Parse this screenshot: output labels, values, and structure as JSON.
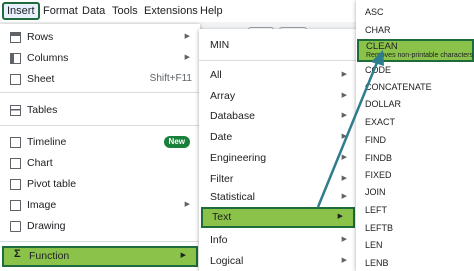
{
  "menubar": {
    "items": [
      "Insert",
      "Format",
      "Data",
      "Tools",
      "Extensions",
      "Help"
    ]
  },
  "insert_menu": {
    "items": [
      {
        "label": "Rows",
        "icon": "rows-icon"
      },
      {
        "label": "Columns",
        "icon": "columns-icon"
      },
      {
        "label": "Sheet",
        "icon": "sheet-icon",
        "shortcut": "Shift+F11"
      },
      {
        "label": "Tables",
        "icon": "tables-icon"
      },
      {
        "label": "Timeline",
        "icon": "timeline-icon",
        "badge": "New"
      },
      {
        "label": "Chart",
        "icon": "chart-icon"
      },
      {
        "label": "Pivot table",
        "icon": "pivot-table-icon"
      },
      {
        "label": "Image",
        "icon": "image-icon"
      },
      {
        "label": "Drawing",
        "icon": "drawing-icon"
      },
      {
        "label": "Function",
        "icon": "sigma-icon",
        "icon_glyph": "Σ"
      }
    ]
  },
  "function_menu": {
    "items": [
      "MIN",
      "All",
      "Array",
      "Database",
      "Date",
      "Engineering",
      "Filter",
      "Statistical",
      "Text",
      "Info",
      "Logical"
    ]
  },
  "text_menu": {
    "items": [
      "ASC",
      "CHAR",
      "CODE",
      "CONCATENATE",
      "DOLLAR",
      "EXACT",
      "FIND",
      "FINDB",
      "FIXED",
      "JOIN",
      "LEFT",
      "LEFTB",
      "LEN",
      "LENB"
    ],
    "highlighted": {
      "label": "CLEAN",
      "description": "Removes non-printable characters"
    }
  },
  "colors": {
    "highlight": "#8bc34a",
    "highlight_border": "#1e6b3c",
    "arrow": "#2e7d8c",
    "badge": "#188038"
  }
}
